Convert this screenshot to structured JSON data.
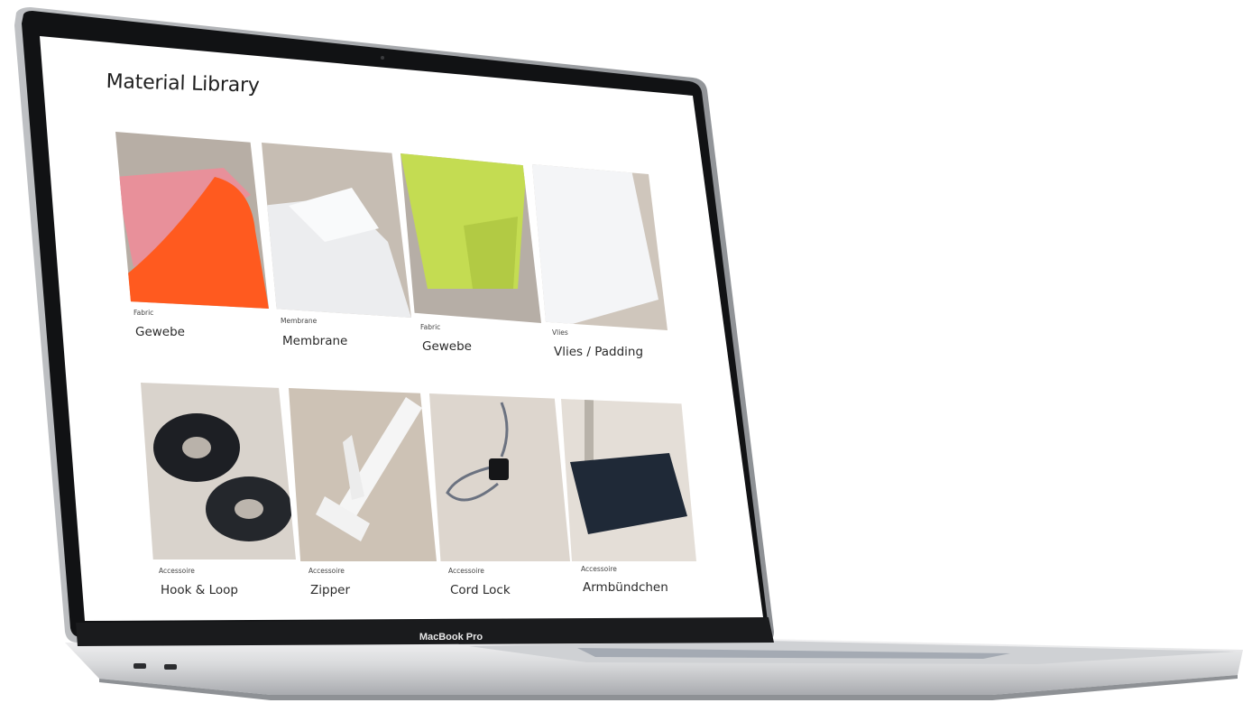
{
  "page": {
    "title": "Material Library"
  },
  "device": {
    "label": "MacBook Pro"
  },
  "materials": [
    {
      "category": "Fabric",
      "name": "Gewebe",
      "icon": "orange-pink-fabric-swatch"
    },
    {
      "category": "Membrane",
      "name": "Membrane",
      "icon": "white-membrane-swatch"
    },
    {
      "category": "Fabric",
      "name": "Gewebe",
      "icon": "lime-fabric-swatch"
    },
    {
      "category": "Vlies",
      "name": "Vlies / Padding",
      "icon": "white-padding-swatch"
    },
    {
      "category": "Accessoire",
      "name": "Hook & Loop",
      "icon": "velcro-roll-photo"
    },
    {
      "category": "Accessoire",
      "name": "Zipper",
      "icon": "white-zipper-photo"
    },
    {
      "category": "Accessoire",
      "name": "Cord Lock",
      "icon": "cord-lock-photo"
    },
    {
      "category": "Accessoire",
      "name": "Armbündchen",
      "icon": "ribbed-cuff-photo"
    }
  ],
  "colors": {
    "swatch_orange": "#ff5a1f",
    "swatch_pink": "#e8909a",
    "swatch_lime": "#c4dc52",
    "backdrop_beige": "#c9beb1",
    "velcro_black": "#1d1f24",
    "cuff_navy": "#1f2937"
  }
}
